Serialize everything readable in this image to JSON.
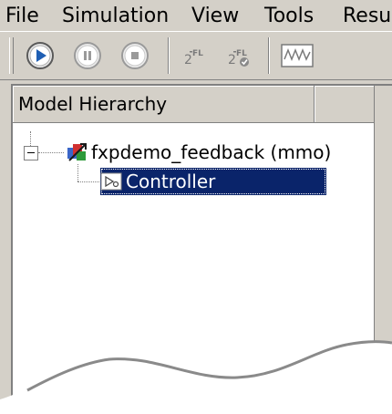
{
  "menubar": {
    "items": [
      "File",
      "Simulation",
      "View",
      "Tools",
      "Resu"
    ]
  },
  "toolbar": {
    "buttons": [
      {
        "name": "play",
        "icon": "play-icon"
      },
      {
        "name": "pause",
        "icon": "pause-icon"
      },
      {
        "name": "stop",
        "icon": "stop-icon"
      },
      {
        "name": "fixed-point-logging",
        "icon": "fixed-point-log-icon",
        "label": "FL"
      },
      {
        "name": "fixed-point-autoscale",
        "icon": "fixed-point-check-icon",
        "label": "FL"
      },
      {
        "name": "signal-view",
        "icon": "waveform-icon"
      }
    ]
  },
  "panel": {
    "title": "Model Hierarchy",
    "tree": {
      "root": {
        "label": "fxpdemo_feedback (mmo)",
        "icon": "simulink-model-icon",
        "expanded": true
      },
      "children": [
        {
          "label": "Controller",
          "icon": "subsystem-block-icon",
          "selected": true
        }
      ]
    }
  },
  "colors": {
    "chrome": "#d4d0c8",
    "selection": "#0a246a",
    "play_blue": "#1f5fb4"
  }
}
